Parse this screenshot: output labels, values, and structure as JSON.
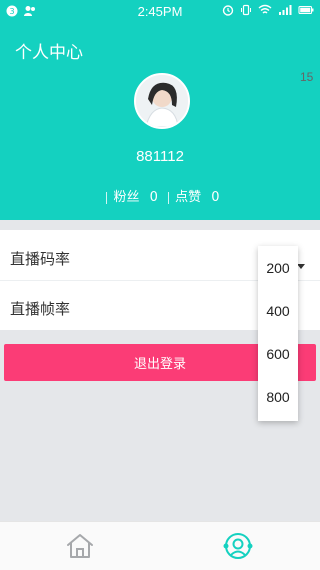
{
  "status_bar": {
    "time": "2:45PM",
    "left_icons": [
      "notification-dot-icon",
      "users-icon"
    ],
    "right_icons": [
      "alarm-icon",
      "vibrate-icon",
      "wifi-icon",
      "signal-icon",
      "battery-icon"
    ]
  },
  "header": {
    "title": "个人中心",
    "user_id": "881112",
    "fans_label": "粉丝",
    "fans_count": "0",
    "likes_label": "点赞",
    "likes_count": "0"
  },
  "settings": {
    "bitrate_label": "直播码率",
    "framerate_label": "直播帧率",
    "framerate_value_partial": "15"
  },
  "dropdown": {
    "options": [
      "200",
      "400",
      "600",
      "800"
    ]
  },
  "logout": {
    "label": "退出登录"
  },
  "colors": {
    "header_bg": "#14d1c0",
    "logout_bg": "#fb3c76",
    "page_bg": "#e5e7ea"
  },
  "tabbar": {
    "items": [
      {
        "icon": "home-icon",
        "active": false
      },
      {
        "icon": "profile-icon",
        "active": true
      }
    ]
  }
}
